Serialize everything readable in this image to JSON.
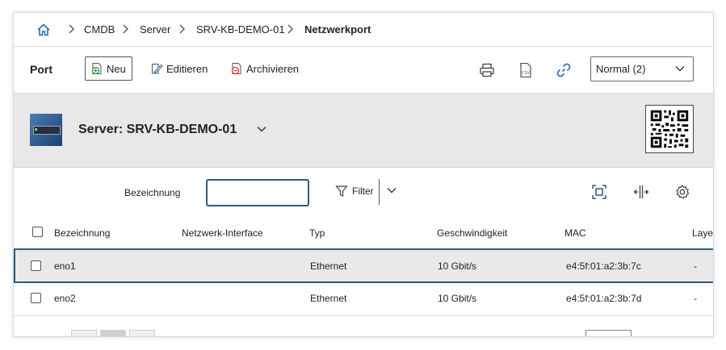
{
  "breadcrumb": {
    "items": [
      "CMDB",
      "Server",
      "SRV-KB-DEMO-01"
    ],
    "current": "Netzwerkport"
  },
  "toolbar": {
    "title": "Port",
    "new_label": "Neu",
    "edit_label": "Editieren",
    "archive_label": "Archivieren",
    "view_select": "Normal (2)"
  },
  "object": {
    "title": "Server: SRV-KB-DEMO-01"
  },
  "filter": {
    "label": "Bezeichnung",
    "input_value": "",
    "filter_label": "Filter"
  },
  "table": {
    "columns": [
      "Bezeichnung",
      "Netzwerk-Interface",
      "Typ",
      "Geschwindigkeit",
      "MAC",
      "Layer"
    ],
    "rows": [
      {
        "bezeichnung": "eno1",
        "interface": "",
        "typ": "Ethernet",
        "geschwindigkeit": "10 Gbit/s",
        "mac": "e4:5f:01:a2:3b:7c",
        "layer": "-"
      },
      {
        "bezeichnung": "eno2",
        "interface": "",
        "typ": "Ethernet",
        "geschwindigkeit": "10 Gbit/s",
        "mac": "e4:5f:01:a2:3b:7d",
        "layer": "-"
      }
    ]
  },
  "colors": {
    "accent": "#2a5d7a",
    "header_band": "#e8e8e8",
    "link_icon": "#2a6fa8"
  }
}
